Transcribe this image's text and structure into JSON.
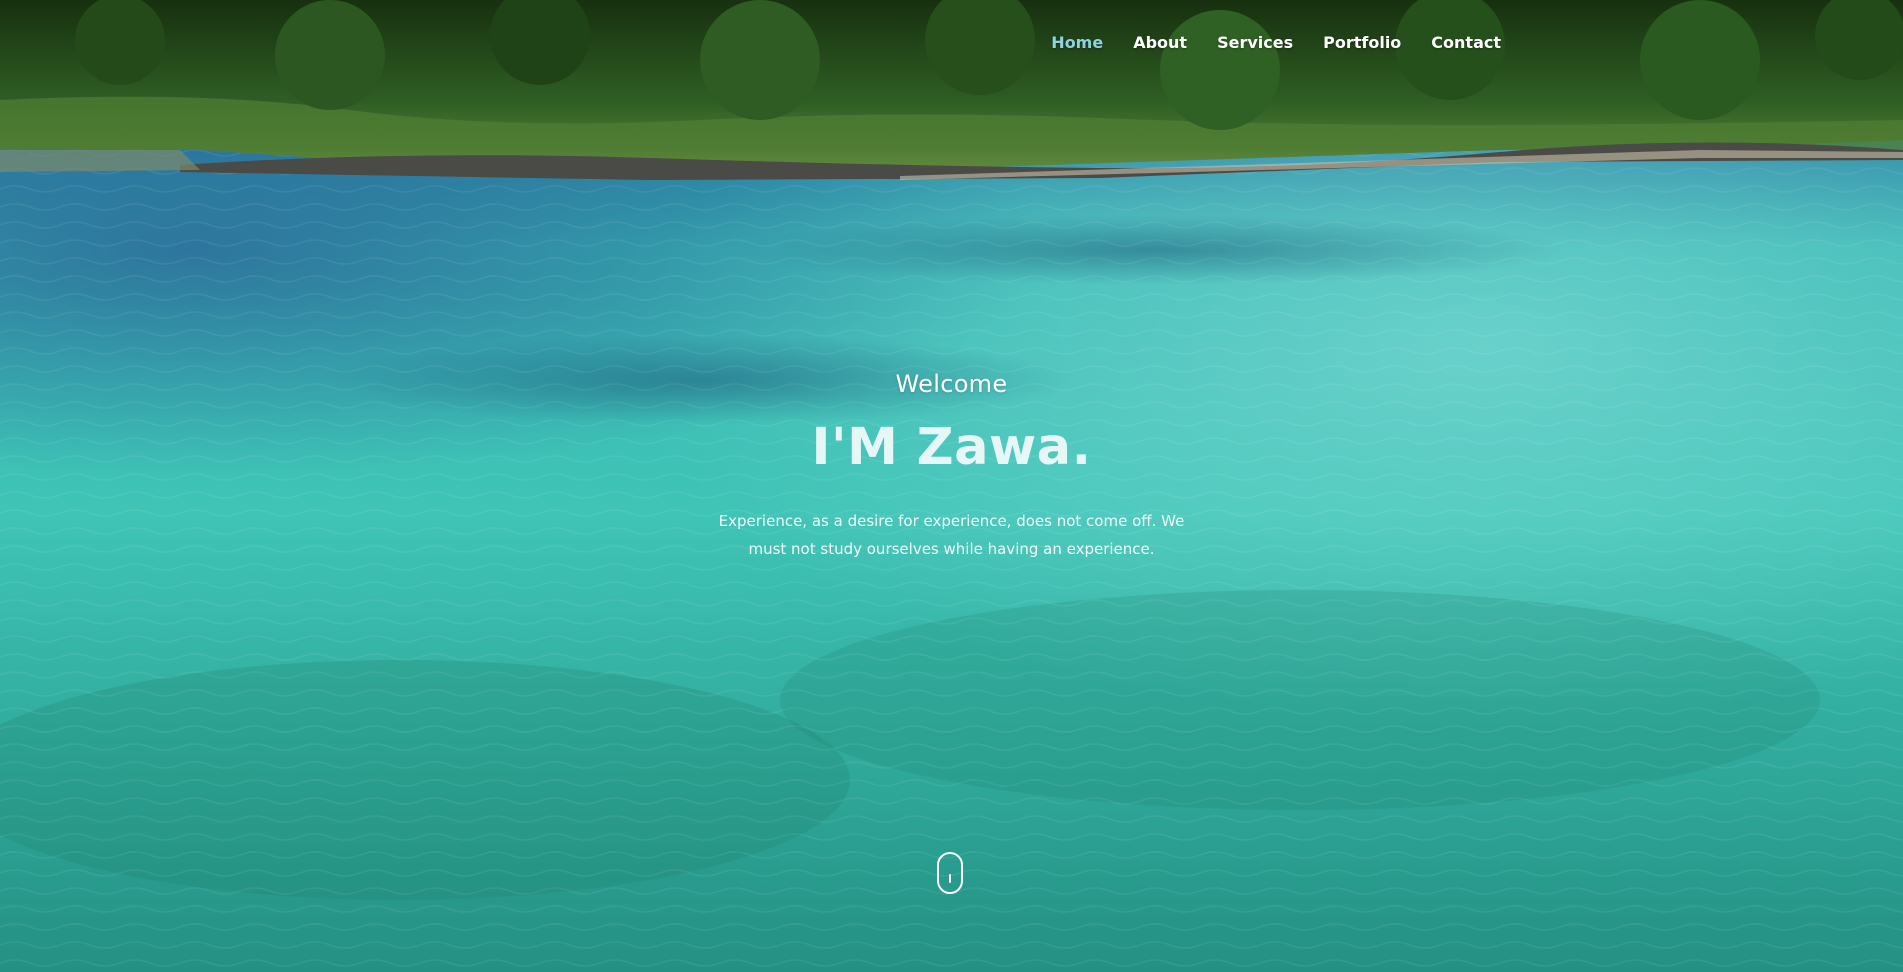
{
  "nav": {
    "items": [
      {
        "label": "Home",
        "active": true
      },
      {
        "label": "About",
        "active": false
      },
      {
        "label": "Services",
        "active": false
      },
      {
        "label": "Portfolio",
        "active": false
      },
      {
        "label": "Contact",
        "active": false
      }
    ],
    "active_color": "#8fd3e0",
    "text_color": "#ffffff"
  },
  "hero": {
    "kicker": "Welcome",
    "title": "I'M Zawa.",
    "description": "Experience, as a desire for experience, does not come off. We must not study ourselves while having an experience.",
    "background": {
      "scene": "tropical-sea-with-green-hillside",
      "water_color": "#2fb3ab",
      "deep_water_color": "#2b6e95",
      "forest_color": "#2f5b24"
    }
  },
  "scroll_indicator": {
    "icon": "mouse-scroll-icon"
  }
}
